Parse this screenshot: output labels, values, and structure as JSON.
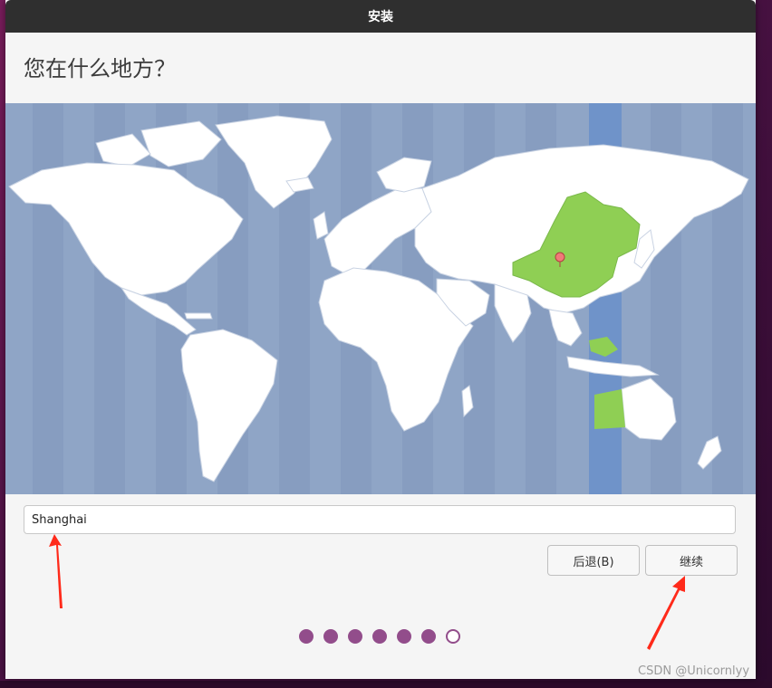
{
  "window": {
    "title": "安装"
  },
  "page": {
    "heading": "您在什么地方？"
  },
  "location": {
    "value": "Shanghai"
  },
  "buttons": {
    "back": "后退(B)",
    "continue": "继续"
  },
  "progress": {
    "total_steps": 7,
    "completed_steps": 6
  },
  "watermark": "CSDN @Unicornlyy",
  "colors": {
    "map_ocean": "#8fa5c6",
    "map_land": "#ffffff",
    "selected_timezone": "#6f93c9",
    "selected_region": "#8fcf54",
    "progress_dot": "#924d8b",
    "annotation_arrow": "#ff2a1a"
  }
}
